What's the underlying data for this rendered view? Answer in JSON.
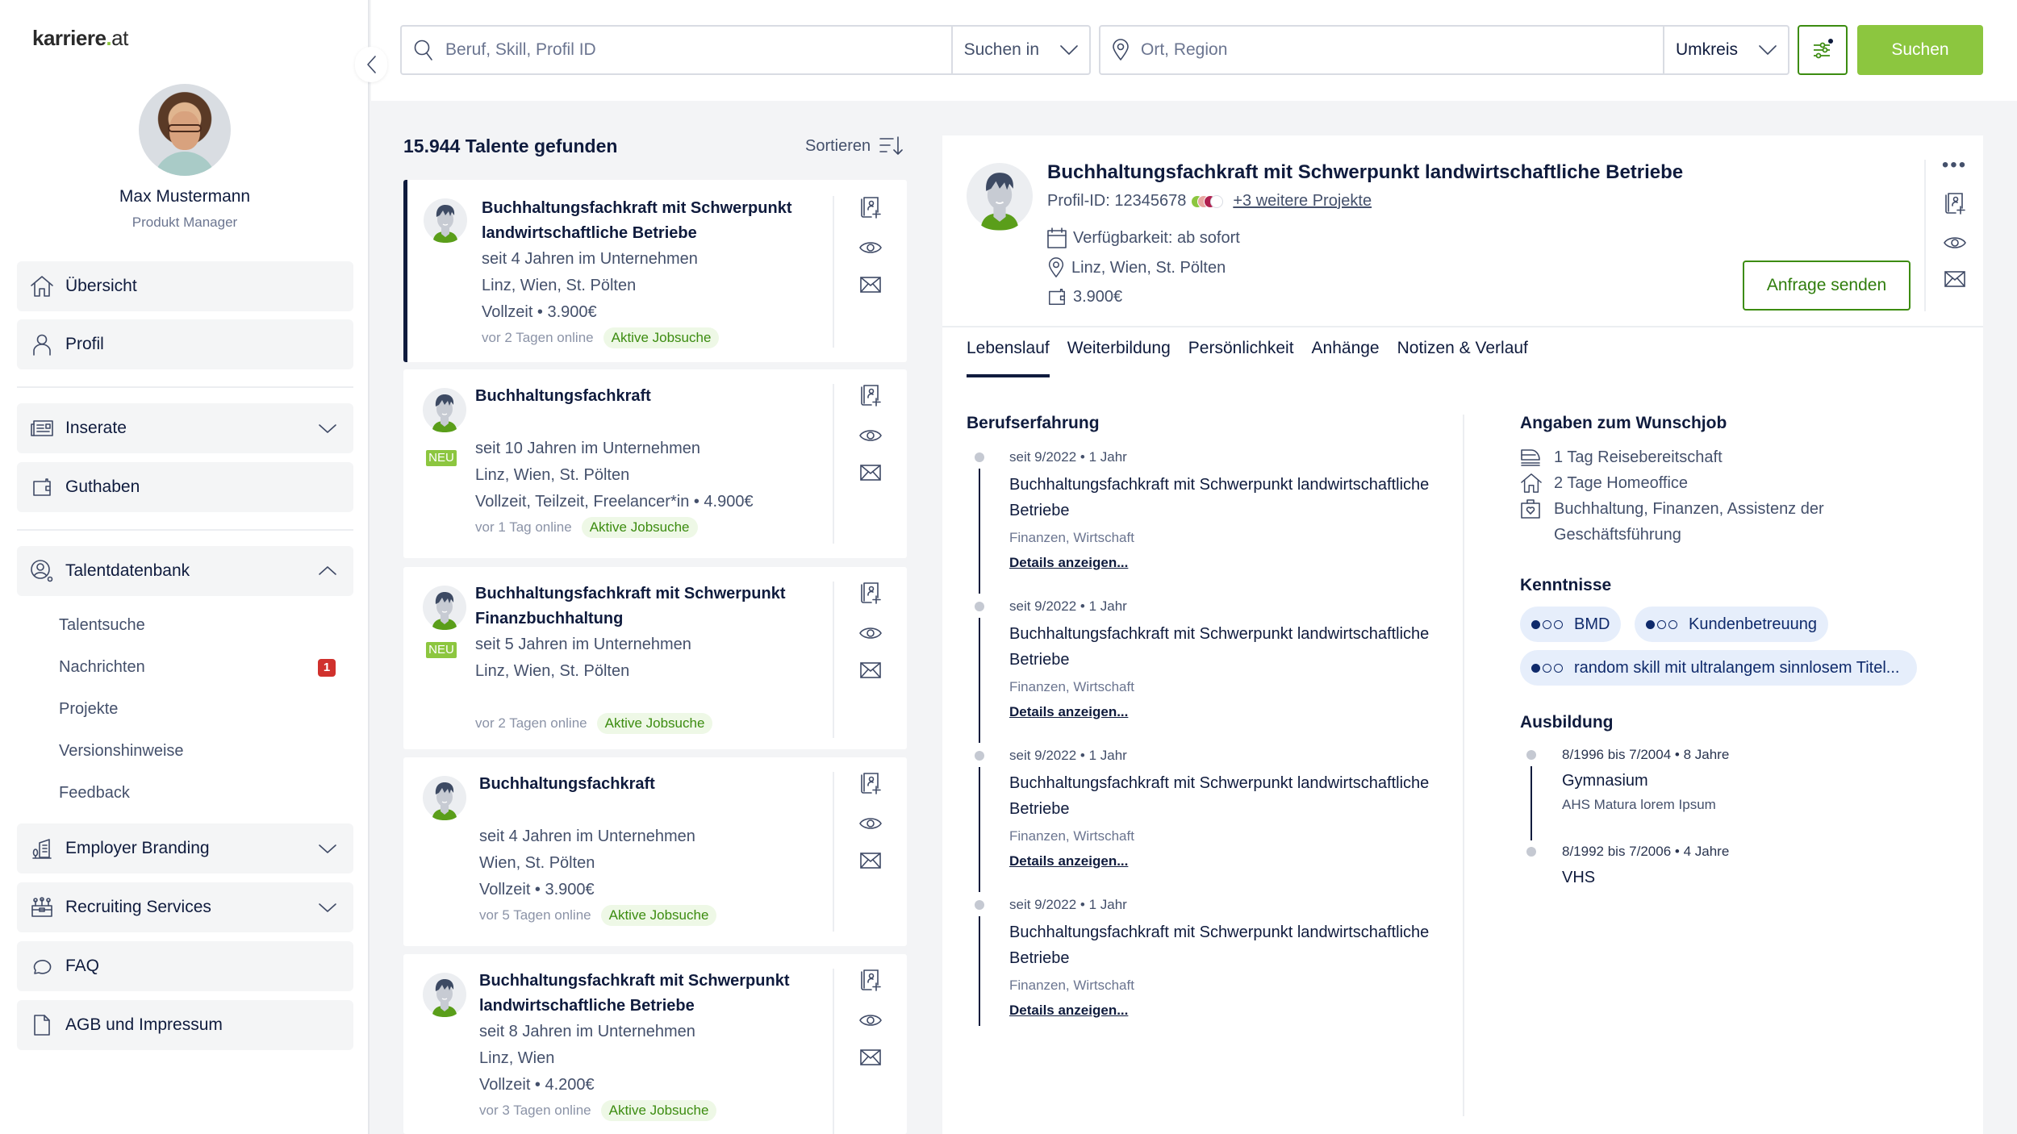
{
  "brand": {
    "name": "karriere",
    "dot": ".",
    "tld": "at",
    "accent": "#8cc63f",
    "primary_dark": "#0f1b3d",
    "success_green": "#3c8c10"
  },
  "user": {
    "name": "Max Mustermann",
    "role": "Produkt Manager"
  },
  "sidebar": {
    "items": [
      {
        "label": "Übersicht",
        "icon": "home-icon"
      },
      {
        "label": "Profil",
        "icon": "user-icon"
      },
      {
        "label": "Inserate",
        "icon": "newspaper-icon",
        "expandable": true,
        "expanded": false
      },
      {
        "label": "Guthaben",
        "icon": "wallet-icon"
      },
      {
        "label": "Talentdatenbank",
        "icon": "talent-search-icon",
        "expandable": true,
        "expanded": true
      },
      {
        "label": "Employer Branding",
        "icon": "building-icon",
        "expandable": true,
        "expanded": false
      },
      {
        "label": "Recruiting Services",
        "icon": "toolbox-icon",
        "expandable": true,
        "expanded": false
      },
      {
        "label": "FAQ",
        "icon": "chat-bubble-icon"
      },
      {
        "label": "AGB und Impressum",
        "icon": "document-icon"
      }
    ],
    "talent_subitems": [
      {
        "label": "Talentsuche"
      },
      {
        "label": "Nachrichten",
        "badge": "1"
      },
      {
        "label": "Projekte"
      },
      {
        "label": "Versionshinweise"
      },
      {
        "label": "Feedback"
      }
    ]
  },
  "search": {
    "query_placeholder": "Beruf, Skill, Profil ID",
    "query_value": "",
    "scope_label": "Suchen in",
    "location_placeholder": "Ort, Region",
    "location_value": "",
    "radius_label": "Umkreis",
    "submit_label": "Suchen"
  },
  "results": {
    "count_label": "15.944 Talente gefunden",
    "sort_label": "Sortieren",
    "cards": [
      {
        "title": "Buchhaltungsfachkraft mit Schwerpunkt landwirtschaftliche Betriebe",
        "new": false,
        "tenure": "seit  4 Jahren im Unternehmen",
        "locations": "Linz, Wien, St. Pölten",
        "terms": "Vollzeit • 3.900€",
        "online": "vor 2 Tagen online",
        "status": "Aktive Jobsuche",
        "active": true
      },
      {
        "title": "Buchhaltungsfachkraft",
        "new": true,
        "new_label": "NEU",
        "tenure": "seit 10 Jahren im Unternehmen",
        "locations": "Linz, Wien, St. Pölten",
        "terms": "Vollzeit, Teilzeit, Freelancer*in • 4.900€",
        "online": "vor 1 Tag online",
        "status": "Aktive Jobsuche"
      },
      {
        "title": "Buchhaltungsfachkraft mit Schwerpunkt Finanzbuchhaltung",
        "new": true,
        "new_label": "NEU",
        "tenure": "seit 5 Jahren im Unternehmen",
        "locations": "Linz, Wien, St. Pölten",
        "terms": "",
        "online": "vor 2 Tagen online",
        "status": "Aktive Jobsuche"
      },
      {
        "title": "Buchhaltungsfachkraft",
        "new": false,
        "tenure": "seit  4 Jahren im Unternehmen",
        "locations": "Wien, St. Pölten",
        "terms": "Vollzeit • 3.900€",
        "online": "vor 5 Tagen online",
        "status": "Aktive Jobsuche"
      },
      {
        "title": "Buchhaltungsfachkraft mit Schwerpunkt landwirtschaftliche Betriebe",
        "new": false,
        "tenure": "seit 8 Jahren im Unternehmen",
        "locations": "Linz, Wien",
        "terms": "Vollzeit • 4.200€",
        "online": "vor 3 Tagen online",
        "status": "Aktive Jobsuche"
      }
    ]
  },
  "detail": {
    "title": "Buchhaltungsfachkraft mit Schwerpunkt landwirtschaftliche Betriebe",
    "profile_id": "Profil-ID: 12345678",
    "project_colors": [
      "#8cc63f",
      "#e8a6a0",
      "#b0204f",
      "#ffffff"
    ],
    "more_projects": "+3 weitere Projekte",
    "availability": "Verfügbarkeit: ab sofort",
    "locations": "Linz, Wien, St. Pölten",
    "salary": "3.900€",
    "send_label": "Anfrage senden",
    "more_label": "•••",
    "tabs": [
      {
        "label": "Lebenslauf",
        "active": true
      },
      {
        "label": "Weiterbildung"
      },
      {
        "label": "Persönlichkeit"
      },
      {
        "label": "Anhänge"
      },
      {
        "label": "Notizen & Verlauf"
      }
    ],
    "experience_title": "Berufserfahrung",
    "experience": [
      {
        "date": "seit 9/2022 • 1 Jahr",
        "title": "Buchhaltungsfachkraft mit Schwerpunkt landwirtschaftliche Betriebe",
        "field": "Finanzen, Wirtschaft",
        "link": "Details anzeigen..."
      },
      {
        "date": "seit 9/2022 • 1 Jahr",
        "title": "Buchhaltungsfachkraft mit Schwerpunkt landwirtschaftliche Betriebe",
        "field": "Finanzen, Wirtschaft",
        "link": "Details anzeigen..."
      },
      {
        "date": "seit 9/2022 • 1 Jahr",
        "title": "Buchhaltungsfachkraft mit Schwerpunkt landwirtschaftliche Betriebe",
        "field": "Finanzen, Wirtschaft",
        "link": "Details anzeigen..."
      },
      {
        "date": "seit 9/2022 • 1 Jahr",
        "title": "Buchhaltungsfachkraft mit Schwerpunkt landwirtschaftliche Betriebe",
        "field": "Finanzen, Wirtschaft",
        "link": "Details anzeigen..."
      }
    ],
    "wish_title": "Angaben zum Wunschjob",
    "wish": [
      {
        "icon": "train-icon",
        "text": "1 Tag Reisebereitschaft"
      },
      {
        "icon": "home-icon",
        "text": "2 Tage Homeoffice"
      },
      {
        "icon": "briefcase-heart-icon",
        "text": "Buchhaltung, Finanzen, Assistenz der Geschäftsführung"
      }
    ],
    "skills_title": "Kenntnisse",
    "skills": [
      {
        "label": "BMD",
        "level": 1,
        "max": 3
      },
      {
        "label": "Kundenbetreuung",
        "level": 1,
        "max": 3
      },
      {
        "label": "random skill mit ultralangem sinnlosem Titel...",
        "level": 1,
        "max": 3
      }
    ],
    "education_title": "Ausbildung",
    "education": [
      {
        "date": "8/1996 bis 7/2004 • 8 Jahre",
        "title": "Gymnasium",
        "sub": "AHS Matura lorem Ipsum"
      },
      {
        "date": "8/1992 bis 7/2006 • 4 Jahre",
        "title": "VHS",
        "sub": ""
      }
    ]
  }
}
